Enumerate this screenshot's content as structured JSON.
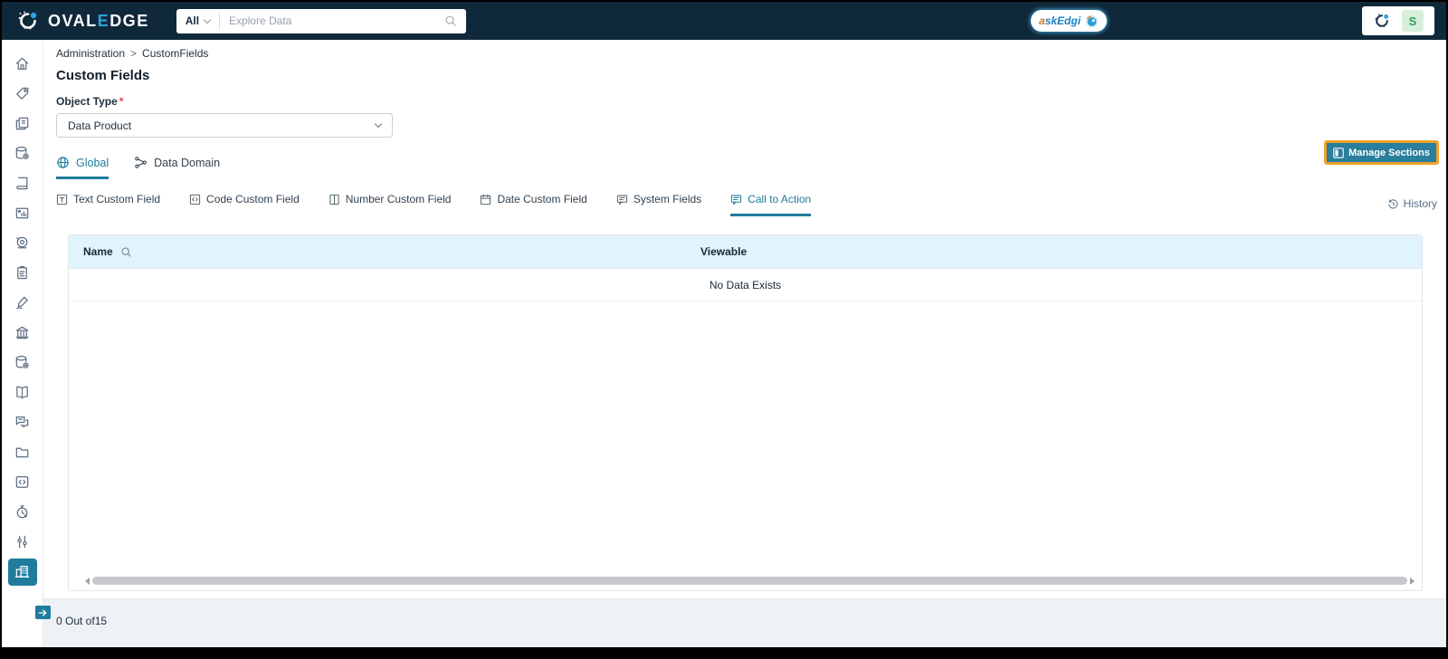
{
  "topbar": {
    "brand": {
      "prefix": "OVAL",
      "accent": "E",
      "suffix": "DGE"
    },
    "search": {
      "scope": "All",
      "placeholder": "Explore Data"
    },
    "askedgi": {
      "first_letter": "a",
      "rest": "skEdgi"
    },
    "avatar_letter": "S"
  },
  "sidebar": {
    "items": [
      {
        "icon": "home-icon"
      },
      {
        "icon": "tag-icon"
      },
      {
        "icon": "pages-icon"
      },
      {
        "icon": "database-settings-icon"
      },
      {
        "icon": "notebook-icon"
      },
      {
        "icon": "report-image-icon"
      },
      {
        "icon": "camera-icon"
      },
      {
        "icon": "clipboard-icon"
      },
      {
        "icon": "signature-icon"
      },
      {
        "icon": "bank-icon"
      },
      {
        "icon": "database-settings-icon"
      },
      {
        "icon": "book-icon"
      },
      {
        "icon": "chat-icon"
      },
      {
        "icon": "folder-icon"
      },
      {
        "icon": "code-file-icon"
      },
      {
        "icon": "timer-icon"
      },
      {
        "icon": "tools-icon"
      },
      {
        "icon": "buildings-icon",
        "selected": true
      }
    ],
    "expand_icon": "arrow-right-icon"
  },
  "breadcrumb": {
    "items": [
      "Administration",
      "CustomFields"
    ],
    "separator": ">"
  },
  "page": {
    "title": "Custom Fields"
  },
  "object_type": {
    "label": "Object Type",
    "required_marker": "*",
    "value": "Data Product"
  },
  "tabs": [
    {
      "label": "Global",
      "icon": "globe-icon",
      "active": true
    },
    {
      "label": "Data Domain",
      "icon": "data-domain-icon",
      "active": false
    }
  ],
  "actions": {
    "manage_sections": "Manage Sections",
    "history": "History"
  },
  "subtabs": [
    {
      "label": "Text Custom Field",
      "icon": "text-custom-field-icon",
      "active": false
    },
    {
      "label": "Code Custom Field",
      "icon": "code-custom-field-icon",
      "active": false
    },
    {
      "label": "Number Custom Field",
      "icon": "number-custom-field-icon",
      "active": false
    },
    {
      "label": "Date Custom Field",
      "icon": "date-custom-field-icon",
      "active": false
    },
    {
      "label": "System Fields",
      "icon": "system-fields-icon",
      "active": false
    },
    {
      "label": "Call to Action",
      "icon": "call-to-action-icon",
      "active": true
    }
  ],
  "table": {
    "columns": [
      "Name",
      "Viewable"
    ],
    "empty_message": "No Data Exists"
  },
  "footer": {
    "count_text": "0 Out of15"
  },
  "colors": {
    "topbar_bg": "#10293a",
    "accent_teal": "#1f7c9c",
    "logo_accent_blue": "#2ea3dc",
    "highlight_orange": "#f0a12b",
    "table_header_bg": "#e1f3fb",
    "footer_bg": "#eef1f6",
    "avatar_bg": "#d8efdc",
    "avatar_text": "#2f9e55",
    "required_red": "#e5484d"
  }
}
